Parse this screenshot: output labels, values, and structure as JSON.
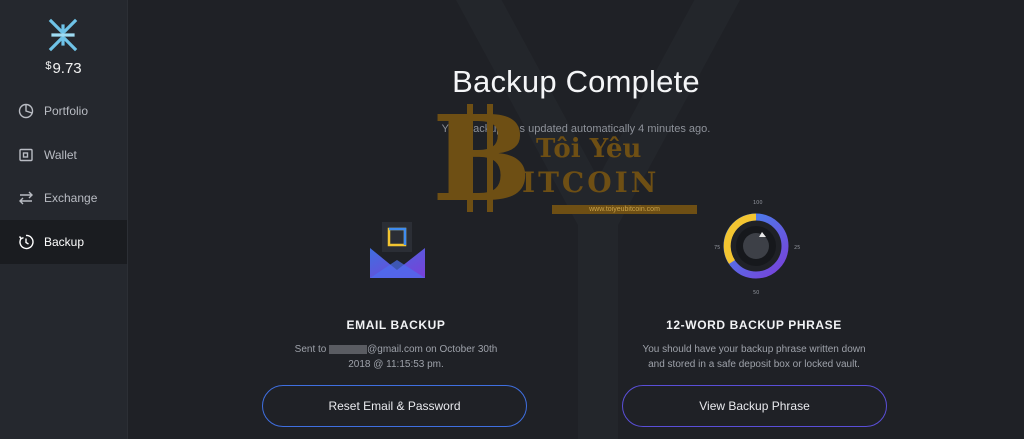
{
  "app": {
    "balance_currency": "$",
    "balance_value": "9.73"
  },
  "sidebar": {
    "items": [
      {
        "label": "Portfolio",
        "icon": "pie-chart-icon"
      },
      {
        "label": "Wallet",
        "icon": "wallet-icon"
      },
      {
        "label": "Exchange",
        "icon": "exchange-arrows-icon"
      },
      {
        "label": "Backup",
        "icon": "backup-clock-icon",
        "active": true
      }
    ]
  },
  "main": {
    "title": "Backup Complete",
    "subtitle": "Your backup was updated automatically 4 minutes ago.",
    "watermark": {
      "line1": "Tôi Yêu",
      "line2": "ITCOIN",
      "side": "BITCOIN",
      "url": "www.toiyeubitcoin.com"
    },
    "email_backup": {
      "title": "EMAIL BACKUP",
      "desc_prefix": "Sent to ",
      "desc_suffix": "@gmail.com on October 30th",
      "desc_line2": "2018 @ 11:15:53 pm.",
      "button_label": "Reset Email & Password"
    },
    "phrase_backup": {
      "title": "12-WORD BACKUP PHRASE",
      "desc_line1": "You should have your backup phrase written down",
      "desc_line2": "and stored in a safe deposit box or locked vault.",
      "button_label": "View Backup Phrase",
      "dial_labels": {
        "top": "100",
        "left": "75",
        "right": "25",
        "bottom": "50"
      }
    }
  },
  "colors": {
    "accent_blue": "#3f6fe0",
    "accent_purple": "#7a3fd8",
    "dial_yellow": "#f3c531",
    "watermark_gold": "#6e4f14"
  }
}
